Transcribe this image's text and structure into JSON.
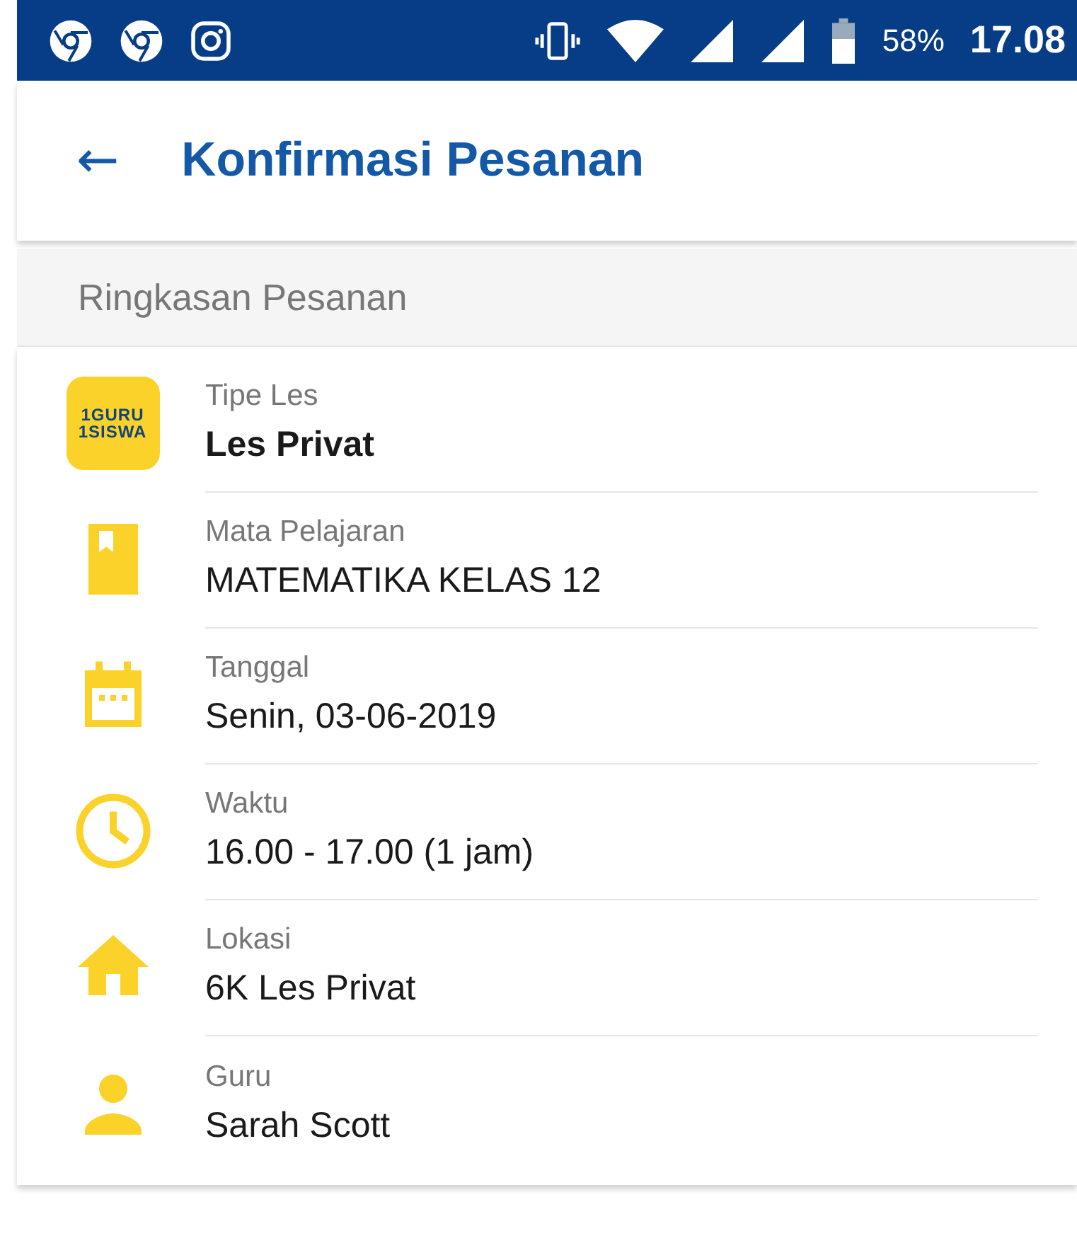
{
  "status_bar": {
    "battery": "58%",
    "time": "17.08"
  },
  "header": {
    "back": "←",
    "title": "Konfirmasi Pesanan"
  },
  "section": {
    "title": "Ringkasan Pesanan"
  },
  "logo": {
    "lines": [
      "1GURU",
      "1SISWA"
    ]
  },
  "rows": [
    {
      "kind": "logo",
      "label": "Tipe Les",
      "value": "Les Privat"
    },
    {
      "kind": "book",
      "label": "Mata Pelajaran",
      "value": "MATEMATIKA KELAS 12"
    },
    {
      "kind": "calendar",
      "label": "Tanggal",
      "value": "Senin, 03-06-2019"
    },
    {
      "kind": "clock",
      "label": "Waktu",
      "value": "16.00 - 17.00 (1 jam)"
    },
    {
      "kind": "home",
      "label": "Lokasi",
      "value": "6K Les Privat"
    },
    {
      "kind": "person",
      "label": "Guru",
      "value": "Sarah Scott"
    }
  ]
}
